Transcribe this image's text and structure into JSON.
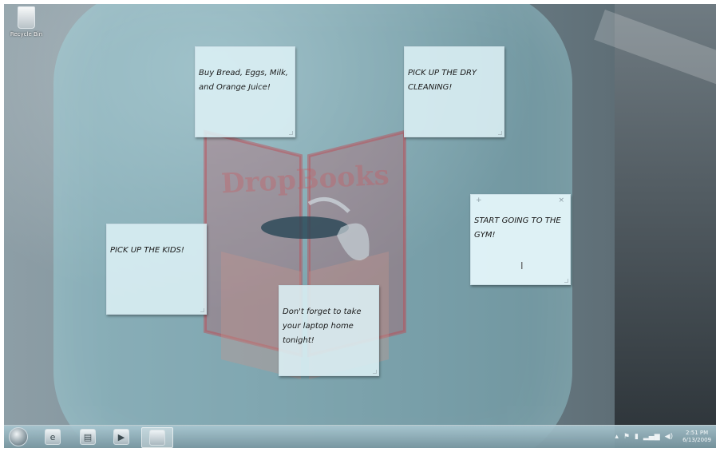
{
  "desktop": {
    "recycle_bin_label": "Recycle Bin",
    "watermark_text": "DropBooks"
  },
  "notes": [
    {
      "text": "Buy Bread, Eggs, Milk, and Orange Juice!"
    },
    {
      "text": "PICK UP THE DRY CLEANING!"
    },
    {
      "text": "START GOING TO THE GYM!",
      "add_glyph": "+",
      "close_glyph": "×",
      "cursor_glyph": "I"
    },
    {
      "text": "PICK UP THE KIDS!"
    },
    {
      "text": "Don't forget to take your laptop home tonight!"
    }
  ],
  "taskbar": {
    "icons": [
      "start-orb-icon",
      "internet-explorer-icon",
      "windows-explorer-icon",
      "media-player-icon",
      "sticky-notes-icon"
    ],
    "clock_time": "2:51 PM",
    "clock_date": "6/13/2009"
  },
  "colors": {
    "note_bg": "#dcf0f5",
    "wallpaper_accent": "#8cd7e1",
    "book_red": "#c0444e"
  }
}
